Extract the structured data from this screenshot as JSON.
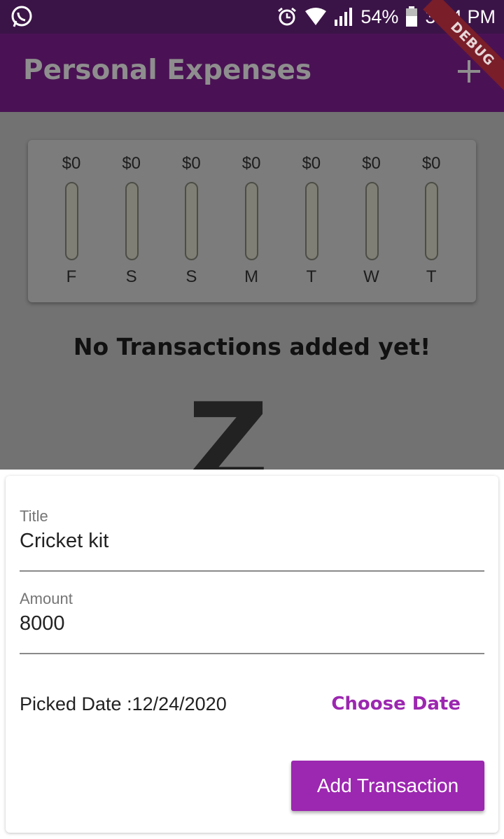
{
  "status_bar": {
    "battery": "54%",
    "time": "3:14 PM"
  },
  "app_bar": {
    "title": "Personal Expenses",
    "debug_label": "DEBUG"
  },
  "chart": {
    "bars": [
      {
        "amount": "$0",
        "day": "F"
      },
      {
        "amount": "$0",
        "day": "S"
      },
      {
        "amount": "$0",
        "day": "S"
      },
      {
        "amount": "$0",
        "day": "M"
      },
      {
        "amount": "$0",
        "day": "T"
      },
      {
        "amount": "$0",
        "day": "W"
      },
      {
        "amount": "$0",
        "day": "T"
      }
    ]
  },
  "empty_state": {
    "text": "No Transactions added yet!",
    "icon_glyph": "Z"
  },
  "form": {
    "title_label": "Title",
    "title_value": "Cricket kit",
    "amount_label": "Amount",
    "amount_value": "8000",
    "picked_date": "Picked Date :12/24/2020",
    "choose_date_label": "Choose Date",
    "submit_label": "Add Transaction"
  },
  "colors": {
    "accent": "#9c27b0",
    "app_bar": "#4a1254"
  }
}
